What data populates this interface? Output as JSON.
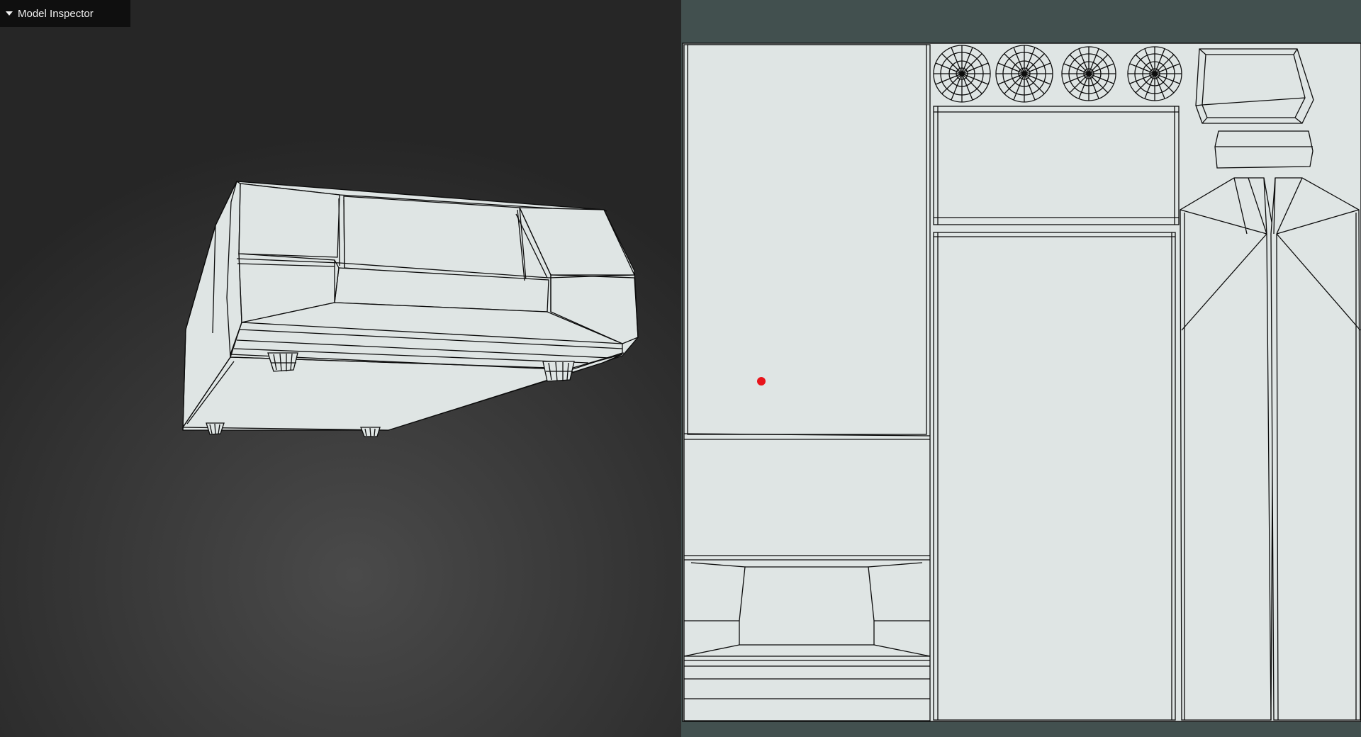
{
  "inspector": {
    "title": "Model Inspector",
    "expanded": true,
    "toggle_icon": "triangle-down-icon"
  },
  "colors": {
    "viewport_bg_center": "#4a4a4a",
    "viewport_bg_edge": "#262626",
    "mesh_fill": "#dfe5e4",
    "wire": "#0c0c0c",
    "uv_panel_bg": "#42504f",
    "uv_sheet": "#dfe5e4",
    "marker": "#e8141b"
  }
}
